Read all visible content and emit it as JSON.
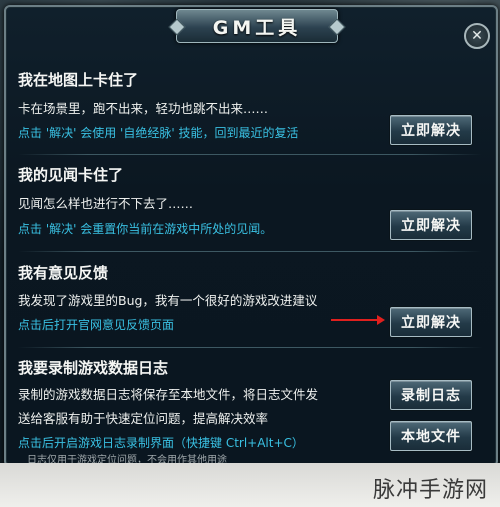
{
  "dialog": {
    "title": "GM工具",
    "close_symbol": "✕"
  },
  "sections": [
    {
      "title": "我在地图上卡住了",
      "desc": "卡在场景里，跑不出来，轻功也跳不出来……",
      "hint": "点击 '解决' 会使用 '自绝经脉' 技能，回到最近的复活",
      "button": "立即解决"
    },
    {
      "title": "我的见闻卡住了",
      "desc": "见闻怎么样也进行不下去了……",
      "hint": "点击 '解决' 会重置你当前在游戏中所处的见闻。",
      "button": "立即解决"
    },
    {
      "title": "我有意见反馈",
      "desc": "我发现了游戏里的Bug，我有一个很好的游戏改进建议",
      "hint": "点击后打开官网意见反馈页面",
      "button": "立即解决"
    },
    {
      "title": "我要录制游戏数据日志",
      "desc_line1": "录制的游戏数据日志将保存至本地文件，将日志文件发",
      "desc_line2": "送给客服有助于快速定位问题，提高解决效率",
      "hint": "点击后开启游戏日志录制界面（快捷键 Ctrl+Alt+C）",
      "button_record": "录制日志",
      "button_local": "本地文件"
    }
  ],
  "footer_note": "日志仅用于游戏定位问题，不会用作其他用途",
  "watermark": "脉冲手游网",
  "colors": {
    "hint": "#39c0e2",
    "arrow": "#e0201e"
  }
}
